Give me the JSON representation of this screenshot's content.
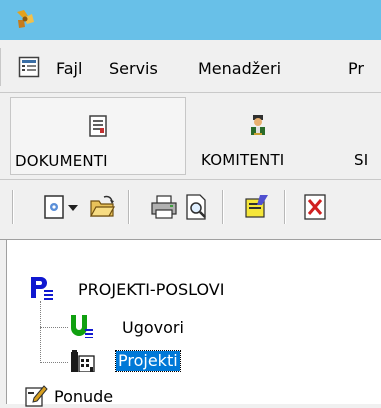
{
  "window": {
    "app_icon": "app-logo-icon",
    "title_bar_color": "#68c0e8"
  },
  "menu": {
    "system_icon": "system-menu-icon",
    "items": [
      {
        "label": "Fajl"
      },
      {
        "label": "Servis"
      },
      {
        "label": "Menadžeri"
      },
      {
        "label": "Pr"
      }
    ]
  },
  "tabs": [
    {
      "label": "DOKUMENTI",
      "icon": "document-icon",
      "selected": true
    },
    {
      "label": "KOMITENTI",
      "icon": "person-icon",
      "selected": false
    },
    {
      "label": "SI",
      "icon": "",
      "selected": false
    }
  ],
  "toolbar": {
    "buttons": [
      {
        "icon": "new-document-icon"
      },
      {
        "icon": "dropdown-arrow-icon"
      },
      {
        "icon": "open-folder-icon"
      },
      {
        "icon": "print-icon"
      },
      {
        "icon": "print-preview-icon"
      },
      {
        "icon": "edit-note-icon"
      },
      {
        "icon": "delete-icon"
      }
    ]
  },
  "tree": {
    "root": {
      "label": "PROJEKTI-POSLOVI",
      "icon": "p-list-icon"
    },
    "children": [
      {
        "label": "Ugovori",
        "icon": "u-list-icon",
        "selected": false
      },
      {
        "label": "Projekti",
        "icon": "building-icon",
        "selected": true
      }
    ],
    "next": {
      "label": "Ponude",
      "icon": "pencil-doc-icon"
    }
  },
  "colors": {
    "selection": "#0078d7",
    "tree_root_icon": "#1018d0",
    "tree_u_icon": "#10a010"
  }
}
